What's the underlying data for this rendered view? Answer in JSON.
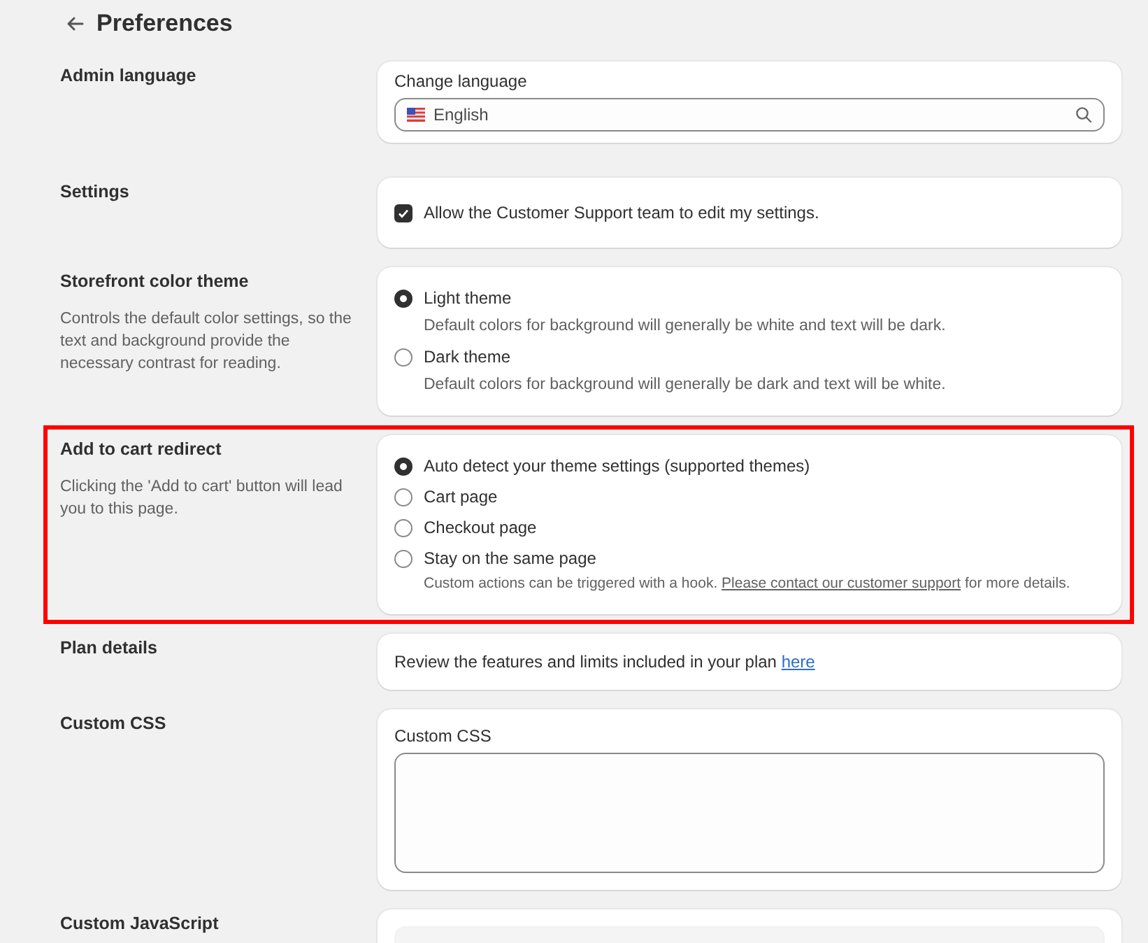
{
  "header": {
    "title": "Preferences"
  },
  "sections": [
    {
      "title": "Admin language",
      "highlighted": false,
      "card": {
        "kind": "select",
        "label": "Change language",
        "value": "English"
      }
    },
    {
      "title": "Settings",
      "highlighted": false,
      "card": {
        "kind": "checkbox",
        "items": [
          {
            "label": "Allow the Customer Support team to edit my settings.",
            "checked": true
          }
        ]
      }
    },
    {
      "title": "Storefront color theme",
      "description": "Controls the default color settings, so the text and background provide the necessary contrast for reading.",
      "highlighted": false,
      "card": {
        "kind": "radio",
        "options": [
          {
            "label": "Light theme",
            "selected": true,
            "note": "Default colors for background will generally be white and text will be dark."
          },
          {
            "label": "Dark theme",
            "selected": false,
            "note": "Default colors for background will generally be dark and text will be white."
          }
        ]
      }
    },
    {
      "title": "Add to cart redirect",
      "description": "Clicking the 'Add to cart' button will lead you to this page.",
      "highlighted": true,
      "card": {
        "kind": "radio",
        "options": [
          {
            "label": "Auto detect your theme settings (supported themes)",
            "selected": true
          },
          {
            "label": "Cart page",
            "selected": false
          },
          {
            "label": "Checkout page",
            "selected": false
          },
          {
            "label": "Stay on the same page",
            "selected": false,
            "note": "Custom actions can be triggered with a hook. ",
            "link": "Please contact our customer support",
            "note_end": " for more details."
          }
        ]
      }
    },
    {
      "title": "Plan details",
      "highlighted": false,
      "card": {
        "kind": "text",
        "text": "Review the features and limits included in your plan ",
        "link": "here"
      }
    },
    {
      "title": "Custom CSS",
      "highlighted": false,
      "card": {
        "kind": "textarea",
        "label": "Custom CSS"
      }
    },
    {
      "title": "Custom JavaScript",
      "highlighted": false,
      "card": {
        "kind": "textarea"
      }
    }
  ]
}
